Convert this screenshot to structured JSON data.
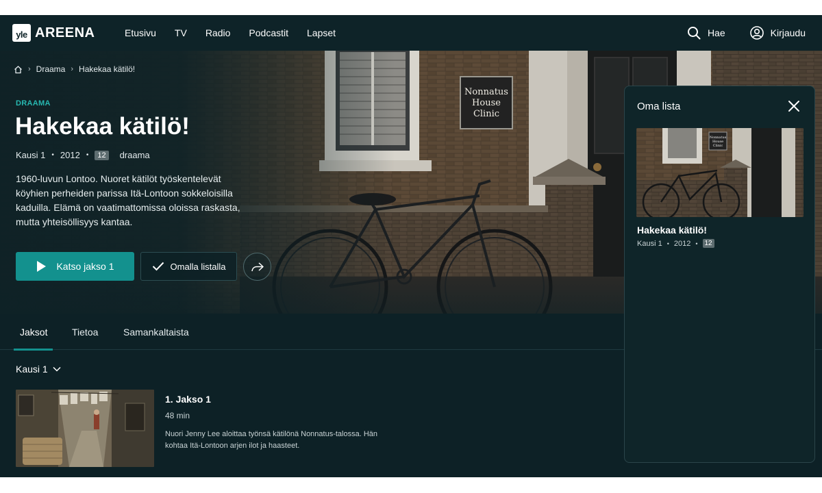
{
  "brand": {
    "badge": "yle",
    "name": "AREENA"
  },
  "nav": {
    "items": [
      "Etusivu",
      "TV",
      "Radio",
      "Podcastit",
      "Lapset"
    ]
  },
  "header": {
    "search_label": "Hae",
    "login_label": "Kirjaudu"
  },
  "breadcrumb": {
    "section": "Draama",
    "current": "Hakekaa kätilö!"
  },
  "hero": {
    "genre": "DRAAMA",
    "title": "Hakekaa kätilö!",
    "season": "Kausi 1",
    "year": "2012",
    "age_rating": "12",
    "category": "draama",
    "description": "1960-luvun Lontoo. Nuoret kätilöt työskentelevät köyhien perheiden parissa Itä-Lontoon sokkeloisilla kaduilla. Elämä on vaatimattomissa oloissa raskasta, mutta yhteisöllisyys kantaa.",
    "sign_text": [
      "Nonnatus",
      "House",
      "Clinic"
    ],
    "watch_label": "Katso jakso 1",
    "list_label": "Omalla listalla"
  },
  "tabs": [
    {
      "label": "Jaksot",
      "active": true
    },
    {
      "label": "Tietoa",
      "active": false
    },
    {
      "label": "Samankaltaista",
      "active": false
    }
  ],
  "season_selector": {
    "label": "Kausi 1"
  },
  "episodes": [
    {
      "title": "1. Jakso 1",
      "duration": "48 min",
      "description": "Nuori Jenny Lee aloittaa työnsä kätilönä Nonnatus-talossa. Hän kohtaa Itä-Lontoon arjen ilot ja haasteet."
    }
  ],
  "panel": {
    "title": "Oma lista",
    "item": {
      "title": "Hakekaa kätilö!",
      "season": "Kausi 1",
      "year": "2012",
      "age_rating": "12"
    }
  },
  "colors": {
    "accent": "#13918e",
    "genre": "#27b7b0",
    "background": "#0d2126"
  }
}
